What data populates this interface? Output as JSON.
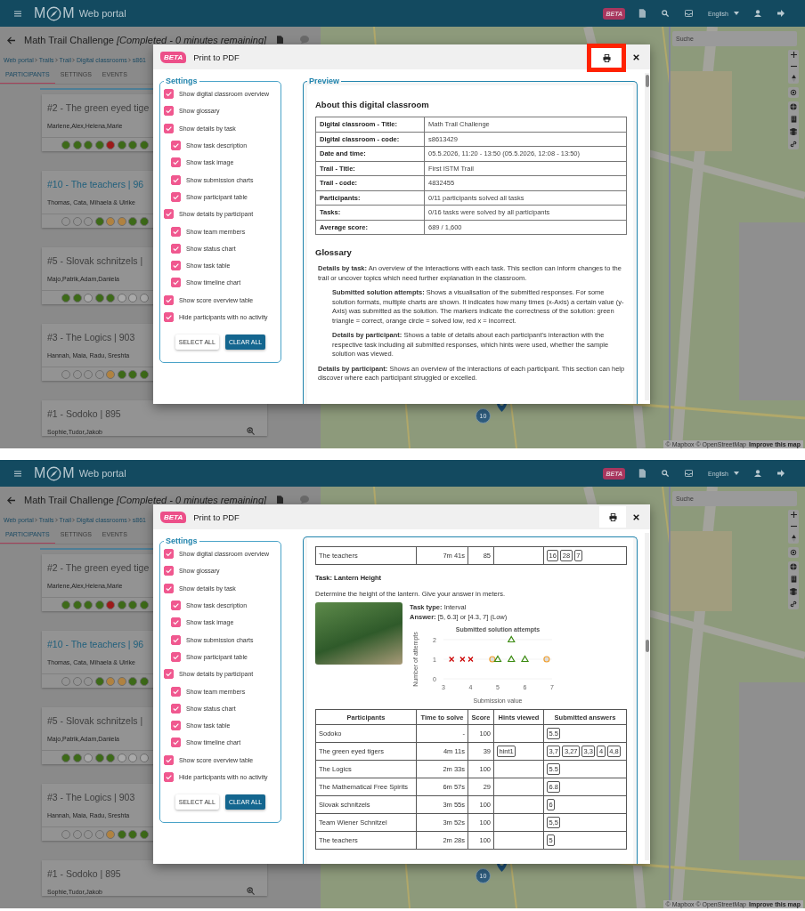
{
  "screens": [
    {
      "header": {
        "logo_left": "M",
        "logo_right": "M",
        "app_name": "Web portal",
        "beta": "BETA",
        "language": "English"
      },
      "page": {
        "title": "Math Trail Challenge *[Completed - 0 minutes remaining]*",
        "breadcrumb": [
          "Web portal",
          "Trails",
          "Trail",
          "Digital classrooms",
          "s861"
        ],
        "tabs": [
          {
            "label": "PARTICIPANTS",
            "selected": true
          },
          {
            "label": "SETTINGS",
            "selected": false
          },
          {
            "label": "EVENTS",
            "selected": false
          }
        ],
        "teams": [
          {
            "title": "#2 - The green eyed tige",
            "members": "Marlene,Alex,Helena,Marie",
            "selected": false,
            "dots": [
              {
                "color": "#3d6a18"
              },
              {
                "color": "#3d6a18"
              },
              {
                "color": "#3d6a18"
              },
              {
                "color": "#3d6a18"
              },
              {
                "color": "#9c1a1a"
              },
              {
                "color": "#3d6a18"
              },
              {
                "color": "#3d6a18"
              },
              {
                "color": "#3d6a18"
              }
            ]
          },
          {
            "title": "#10 - The teachers | 96",
            "members": "Thomas, Cata, Mihaela & Ulrike",
            "selected": true,
            "dots": [
              {
                "color": "#939393"
              },
              {
                "color": "#939393"
              },
              {
                "color": "#939393"
              },
              {
                "color": "#3d6a18"
              },
              {
                "color": "#b08240"
              },
              {
                "color": "#b08240"
              },
              {
                "color": "#3d6a18"
              },
              {
                "color": "#3d6a18"
              }
            ]
          },
          {
            "title": "#5 - Slovak schnitzels |",
            "members": "Majo,Patrik,Adam,Daniela",
            "selected": false,
            "dots": [
              {
                "color": "#3d6a18"
              },
              {
                "color": "#3d6a18"
              },
              {
                "color": "#a9a9a9"
              },
              {
                "color": "#3d6a18"
              },
              {
                "color": "#3d6a18"
              },
              {
                "color": "#a9a9a9"
              },
              {
                "color": "#a9a9a9"
              },
              {
                "color": "#a9a9a9"
              }
            ]
          },
          {
            "title": "#3 - The Logics | 903",
            "members": "Hannah, Maia, Radu, Sreshta",
            "selected": false,
            "dots": [
              {
                "color": "#939393"
              },
              {
                "color": "#939393"
              },
              {
                "color": "#939393"
              },
              {
                "color": "#939393"
              },
              {
                "color": "#b08240"
              },
              {
                "color": "#3d6a18"
              },
              {
                "color": "#3d6a18"
              },
              {
                "color": "#3d6a18"
              }
            ]
          },
          {
            "title": "#1 - Sodoko | 895",
            "members": "Sophie,Tudor,Jakob",
            "selected": false
          }
        ]
      },
      "map": {
        "search": {
          "placeholder": "Suche"
        },
        "cluster": "10",
        "attribution": "© Mapbox © OpenStreetMap",
        "improve_link": "Improve this map"
      },
      "modal": {
        "beta": "BETA",
        "title": "Print to PDF",
        "print_highlighted": true,
        "settings": {
          "legend": "Settings",
          "items": [
            {
              "label": "Show digital classroom overview",
              "checked": true
            },
            {
              "label": "Show glossary",
              "checked": true
            },
            {
              "label": "Show details by task",
              "checked": true,
              "children": [
                {
                  "label": "Show task description",
                  "checked": true
                },
                {
                  "label": "Show task image",
                  "checked": true
                },
                {
                  "label": "Show submission charts",
                  "checked": true
                },
                {
                  "label": "Show participant table",
                  "checked": true
                }
              ]
            },
            {
              "label": "Show details by participant",
              "checked": true,
              "children": [
                {
                  "label": "Show team members",
                  "checked": true
                },
                {
                  "label": "Show status chart",
                  "checked": true
                },
                {
                  "label": "Show task table",
                  "checked": true
                },
                {
                  "label": "Show timeline chart",
                  "checked": true
                }
              ]
            },
            {
              "label": "Show score overview table",
              "checked": true
            },
            {
              "label": "Hide participants with no activity",
              "checked": true
            }
          ],
          "buttons": [
            "SELECT ALL",
            "CLEAR ALL"
          ]
        },
        "preview": {
          "legend": "Preview",
          "blocks": [
            {
              "kind": "heading",
              "text": "About this digital classroom"
            },
            {
              "kind": "kv_table",
              "rows": [
                {
                  "label": "Digital classroom - Title:",
                  "value": "Math Trail Challenge"
                },
                {
                  "label": "Digital classroom - code:",
                  "value": "s8613429"
                },
                {
                  "label": "Date and time:",
                  "value": "05.5.2026, 11:20 - 13:50 (05.5.2026, 12:08 - 13:50)"
                },
                {
                  "label": "Trail - Title:",
                  "value": "First ISTM Trail"
                },
                {
                  "label": "Trail - code:",
                  "value": "4832455"
                },
                {
                  "label": "Participants:",
                  "value": "0/11 participants solved all tasks"
                },
                {
                  "label": "Tasks:",
                  "value": "0/16 tasks were solved by all participants"
                },
                {
                  "label": "Average score:",
                  "value": "689 / 1,600"
                }
              ]
            },
            {
              "kind": "heading",
              "text": "Glossary"
            },
            {
              "kind": "glossary",
              "entries": [
                {
                  "text": "**Details by task:** An overview of the interactions with each task. This section can inform changes to the trail or uncover topics which need further explanation in the classroom.",
                  "children": [
                    {
                      "text": "**Submitted solution attempts:** Shows a visualisation of the submitted responses. For some solution formats, multiple charts are shown. It indicates how many times (x-Axis) a certain value (y-Axis) was submitted as the solution. The markers indicate the correctness of the solution: green triangle = correct, orange circle = solved low, red x = incorrect."
                    },
                    {
                      "text": "**Details by participant:** Shows a table of details about each participant's interaction with the respective task including all submitted responses, which hints were used, whether the sample solution was viewed."
                    }
                  ]
                },
                {
                  "text": "**Details by participant:** Shows an overview of the interactions of each participant. This section can help discover where each participant struggled or excelled."
                }
              ]
            }
          ]
        }
      }
    },
    {
      "header": {
        "logo_left": "M",
        "logo_right": "M",
        "app_name": "Web portal",
        "beta": "BETA",
        "language": "English"
      },
      "page": {
        "title": "Math Trail Challenge *[Completed - 0 minutes remaining]*",
        "breadcrumb": [
          "Web portal",
          "Trails",
          "Trail",
          "Digital classrooms",
          "s861"
        ],
        "tabs": [
          {
            "label": "PARTICIPANTS",
            "selected": true
          },
          {
            "label": "SETTINGS",
            "selected": false
          },
          {
            "label": "EVENTS",
            "selected": false
          }
        ],
        "teams": [
          {
            "title": "#2 - The green eyed tige",
            "members": "Marlene,Alex,Helena,Marie",
            "selected": false,
            "dots": [
              {
                "color": "#3d6a18"
              },
              {
                "color": "#3d6a18"
              },
              {
                "color": "#3d6a18"
              },
              {
                "color": "#3d6a18"
              },
              {
                "color": "#9c1a1a"
              },
              {
                "color": "#3d6a18"
              },
              {
                "color": "#3d6a18"
              },
              {
                "color": "#3d6a18"
              }
            ]
          },
          {
            "title": "#10 - The teachers | 96",
            "members": "Thomas, Cata, Mihaela & Ulrike",
            "selected": true,
            "dots": [
              {
                "color": "#939393"
              },
              {
                "color": "#939393"
              },
              {
                "color": "#939393"
              },
              {
                "color": "#3d6a18"
              },
              {
                "color": "#b08240"
              },
              {
                "color": "#b08240"
              },
              {
                "color": "#3d6a18"
              },
              {
                "color": "#3d6a18"
              }
            ]
          },
          {
            "title": "#5 - Slovak schnitzels |",
            "members": "Majo,Patrik,Adam,Daniela",
            "selected": false,
            "dots": [
              {
                "color": "#3d6a18"
              },
              {
                "color": "#3d6a18"
              },
              {
                "color": "#a9a9a9"
              },
              {
                "color": "#3d6a18"
              },
              {
                "color": "#3d6a18"
              },
              {
                "color": "#a9a9a9"
              },
              {
                "color": "#a9a9a9"
              },
              {
                "color": "#a9a9a9"
              }
            ]
          },
          {
            "title": "#3 - The Logics | 903",
            "members": "Hannah, Maia, Radu, Sreshta",
            "selected": false,
            "dots": [
              {
                "color": "#939393"
              },
              {
                "color": "#939393"
              },
              {
                "color": "#939393"
              },
              {
                "color": "#939393"
              },
              {
                "color": "#b08240"
              },
              {
                "color": "#3d6a18"
              },
              {
                "color": "#3d6a18"
              },
              {
                "color": "#3d6a18"
              }
            ]
          },
          {
            "title": "#1 - Sodoko | 895",
            "members": "Sophie,Tudor,Jakob",
            "selected": false
          }
        ]
      },
      "map": {
        "search": {
          "placeholder": "Suche"
        },
        "cluster": "10",
        "attribution": "© Mapbox © OpenStreetMap",
        "improve_link": "Improve this map"
      },
      "modal": {
        "beta": "BETA",
        "title": "Print to PDF",
        "print_highlighted": false,
        "settings": {
          "legend": "Settings",
          "items": [
            {
              "label": "Show digital classroom overview",
              "checked": true
            },
            {
              "label": "Show glossary",
              "checked": true
            },
            {
              "label": "Show details by task",
              "checked": true,
              "children": [
                {
                  "label": "Show task description",
                  "checked": true
                },
                {
                  "label": "Show task image",
                  "checked": true
                },
                {
                  "label": "Show submission charts",
                  "checked": true
                },
                {
                  "label": "Show participant table",
                  "checked": true
                }
              ]
            },
            {
              "label": "Show details by participant",
              "checked": true,
              "children": [
                {
                  "label": "Show team members",
                  "checked": true
                },
                {
                  "label": "Show status chart",
                  "checked": true
                },
                {
                  "label": "Show task table",
                  "checked": true
                },
                {
                  "label": "Show timeline chart",
                  "checked": true
                }
              ]
            },
            {
              "label": "Show score overview table",
              "checked": true
            },
            {
              "label": "Hide participants with no activity",
              "checked": true
            }
          ],
          "buttons": [
            "SELECT ALL",
            "CLEAR ALL"
          ]
        },
        "preview": {
          "blocks": [
            {
              "kind": "table",
              "rows": [
                {
                  "participant": "The teachers",
                  "time": "7m 41s",
                  "score": "85",
                  "answers": [
                    "16",
                    "28",
                    "7"
                  ]
                }
              ]
            },
            {
              "kind": "task_title",
              "text": "Task: Lantern Height"
            },
            {
              "kind": "paragraph",
              "text": "Determine the height of the lantern. Give your answer in meters."
            },
            {
              "kind": "task_info",
              "lines": [
                "**Task type:** Interval",
                "**Answer:** [5, 6.3] or [4.3, 7] (Low)"
              ],
              "chart_data": {
                "type": "scatter",
                "title": "Submitted solution attempts",
                "xlabel": "Submission value",
                "ylabel": "Number of attempts",
                "xlim": [
                  3,
                  7
                ],
                "ylim": [
                  0,
                  2
                ],
                "xticks": [
                  3,
                  4,
                  5,
                  6,
                  7
                ],
                "yticks": [
                  0,
                  1,
                  2
                ],
                "series": [
                  {
                    "marker": "cross",
                    "color": "#cc0000",
                    "x": [
                      3.3,
                      3.7,
                      4
                    ],
                    "values": [
                      1,
                      1,
                      1
                    ]
                  },
                  {
                    "marker": "circle",
                    "color": "#f0a030",
                    "x": [
                      4.8,
                      6.8
                    ],
                    "values": [
                      1,
                      1
                    ]
                  },
                  {
                    "marker": "triangle",
                    "color": "#3a8a10",
                    "x": [
                      5,
                      5.5,
                      5.5,
                      6
                    ],
                    "values": [
                      1,
                      2,
                      1,
                      1
                    ]
                  }
                ]
              }
            },
            {
              "kind": "table",
              "columns": [
                "Participants",
                "Time to solve",
                "Score",
                "Hints viewed",
                "Submitted answers"
              ],
              "rows": [
                {
                  "participant": "Sodoko",
                  "time": "-",
                  "score": "100",
                  "answers": [
                    "5.5"
                  ]
                },
                {
                  "participant": "The green eyed tigers",
                  "time": "4m 11s",
                  "score": "39",
                  "hints": [
                    "hint1"
                  ],
                  "answers": [
                    "3,7",
                    "3,27",
                    "3,3",
                    "4",
                    "4,8"
                  ]
                },
                {
                  "participant": "The Logics",
                  "time": "2m 33s",
                  "score": "100",
                  "answers": [
                    "5.5"
                  ]
                },
                {
                  "participant": "The Mathematical Free Spirits",
                  "time": "6m 57s",
                  "score": "29",
                  "answers": [
                    "6.8"
                  ]
                },
                {
                  "participant": "Slovak schnitzels",
                  "time": "3m 55s",
                  "score": "100",
                  "answers": [
                    "6"
                  ]
                },
                {
                  "participant": "Team Wiener Schnitzel",
                  "time": "3m 52s",
                  "score": "100",
                  "answers": [
                    "5,5"
                  ]
                },
                {
                  "participant": "The teachers",
                  "time": "2m 28s",
                  "score": "100",
                  "answers": [
                    "5"
                  ]
                }
              ]
            }
          ]
        }
      }
    }
  ]
}
